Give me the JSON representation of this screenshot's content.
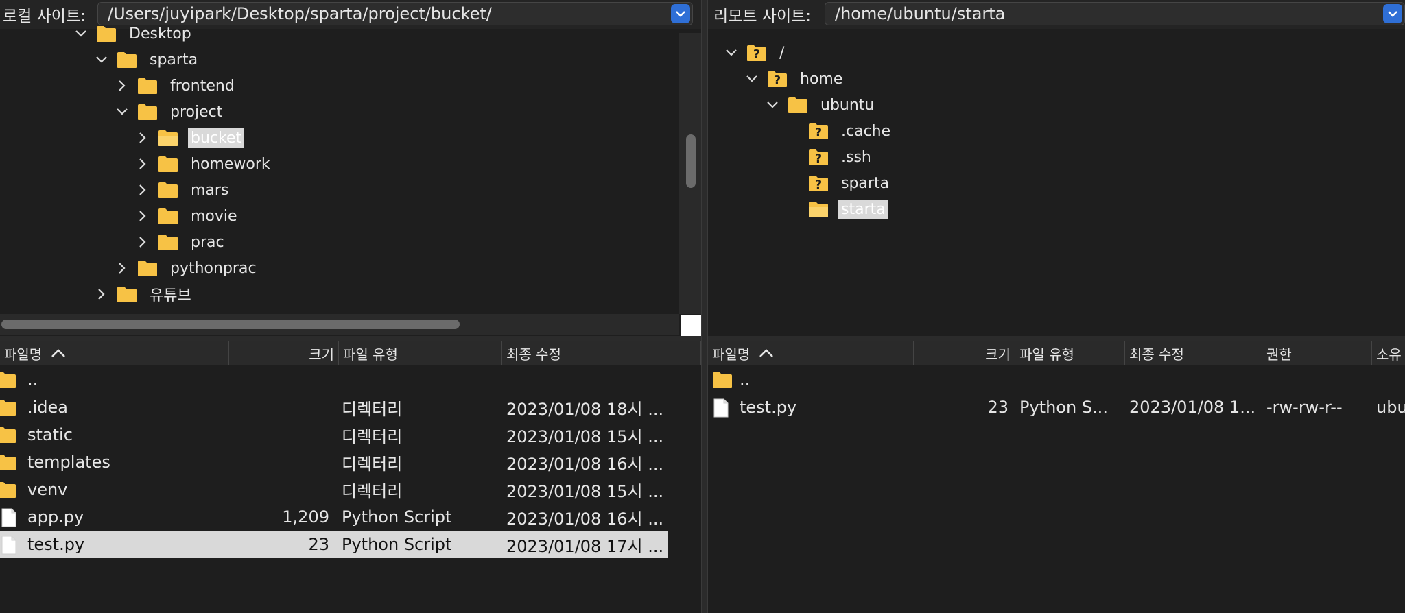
{
  "local": {
    "label": "로컬 사이트:",
    "path": "/Users/juyipark/Desktop/sparta/project/bucket/",
    "tree": [
      {
        "label": "Desktop",
        "expanded": true
      },
      {
        "label": "sparta",
        "expanded": true
      },
      {
        "label": "frontend",
        "expanded": false
      },
      {
        "label": "project",
        "expanded": true
      },
      {
        "label": "bucket",
        "expanded": false,
        "selected": true
      },
      {
        "label": "homework",
        "expanded": false
      },
      {
        "label": "mars",
        "expanded": false
      },
      {
        "label": "movie",
        "expanded": false
      },
      {
        "label": "prac",
        "expanded": false
      },
      {
        "label": "pythonprac",
        "expanded": false
      },
      {
        "label": "유튜브",
        "expanded": false
      }
    ],
    "columns": {
      "name": "파일명",
      "size": "크기",
      "type": "파일 유형",
      "modified": "최종 수정"
    },
    "files": [
      {
        "name": "..",
        "size": "",
        "type": "",
        "modified": "",
        "kind": "folder"
      },
      {
        "name": ".idea",
        "size": "",
        "type": "디렉터리",
        "modified": "2023/01/08 18시 ...",
        "kind": "folder"
      },
      {
        "name": "static",
        "size": "",
        "type": "디렉터리",
        "modified": "2023/01/08 15시 ...",
        "kind": "folder"
      },
      {
        "name": "templates",
        "size": "",
        "type": "디렉터리",
        "modified": "2023/01/08 16시 ...",
        "kind": "folder"
      },
      {
        "name": "venv",
        "size": "",
        "type": "디렉터리",
        "modified": "2023/01/08 15시 ...",
        "kind": "folder"
      },
      {
        "name": "app.py",
        "size": "1,209",
        "type": "Python Script",
        "modified": "2023/01/08 16시 ...",
        "kind": "file"
      },
      {
        "name": "test.py",
        "size": "23",
        "type": "Python Script",
        "modified": "2023/01/08 17시 ...",
        "kind": "file",
        "selected": true
      }
    ]
  },
  "remote": {
    "label": "리모트 사이트:",
    "path": "/home/ubuntu/starta",
    "tree": [
      {
        "label": "/",
        "expanded": true,
        "unknown": true
      },
      {
        "label": "home",
        "expanded": true,
        "unknown": true
      },
      {
        "label": "ubuntu",
        "expanded": true
      },
      {
        "label": ".cache",
        "unknown": true
      },
      {
        "label": ".ssh",
        "unknown": true
      },
      {
        "label": "sparta",
        "unknown": true
      },
      {
        "label": "starta",
        "selected": true
      }
    ],
    "columns": {
      "name": "파일명",
      "size": "크기",
      "type": "파일 유형",
      "modified": "최종 수정",
      "permissions": "권한",
      "owner": "소유"
    },
    "files": [
      {
        "name": "..",
        "size": "",
        "type": "",
        "modified": "",
        "permissions": "",
        "owner": "",
        "kind": "folder"
      },
      {
        "name": "test.py",
        "size": "23",
        "type": "Python S...",
        "modified": "2023/01/08 1...",
        "permissions": "-rw-rw-r--",
        "owner": "ubu",
        "kind": "file"
      }
    ]
  }
}
